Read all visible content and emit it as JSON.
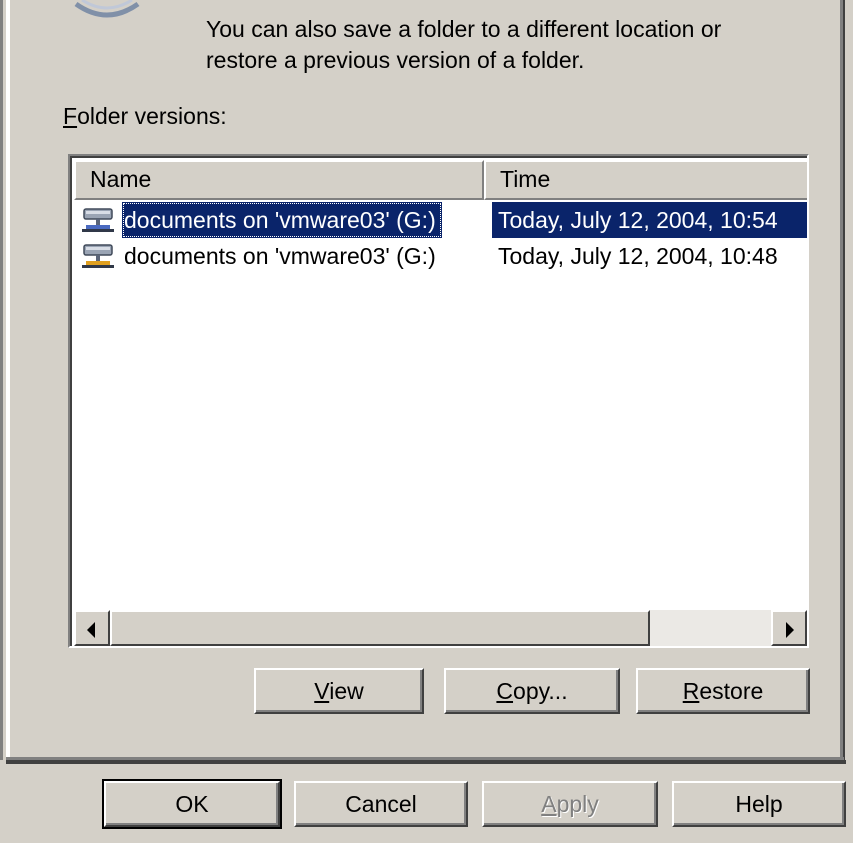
{
  "description": {
    "line1": "You can also save a folder to a different location or",
    "line2": "restore a previous version of a folder."
  },
  "versions_label": {
    "accel": "F",
    "rest": "older versions:"
  },
  "list": {
    "columns": {
      "name": "Name",
      "time": "Time"
    },
    "rows": [
      {
        "name": "documents on 'vmware03' (G:)",
        "time": "Today, July 12, 2004, 10:54",
        "selected": true,
        "icon": "network-drive-icon"
      },
      {
        "name": "documents on 'vmware03' (G:)",
        "time": "Today, July 12, 2004, 10:48",
        "selected": false,
        "icon": "network-drive-icon"
      }
    ]
  },
  "actions": {
    "view": {
      "accel": "V",
      "rest": "iew"
    },
    "copy": {
      "accel": "C",
      "rest": "opy..."
    },
    "restore": {
      "accel": "R",
      "rest": "estore"
    }
  },
  "dialog_buttons": {
    "ok": "OK",
    "cancel": "Cancel",
    "apply": {
      "accel": "A",
      "rest": "pply"
    },
    "help": "Help"
  },
  "colors": {
    "face": "#d4d0c8",
    "selection": "#0a246a",
    "disabled_text": "#808080"
  }
}
